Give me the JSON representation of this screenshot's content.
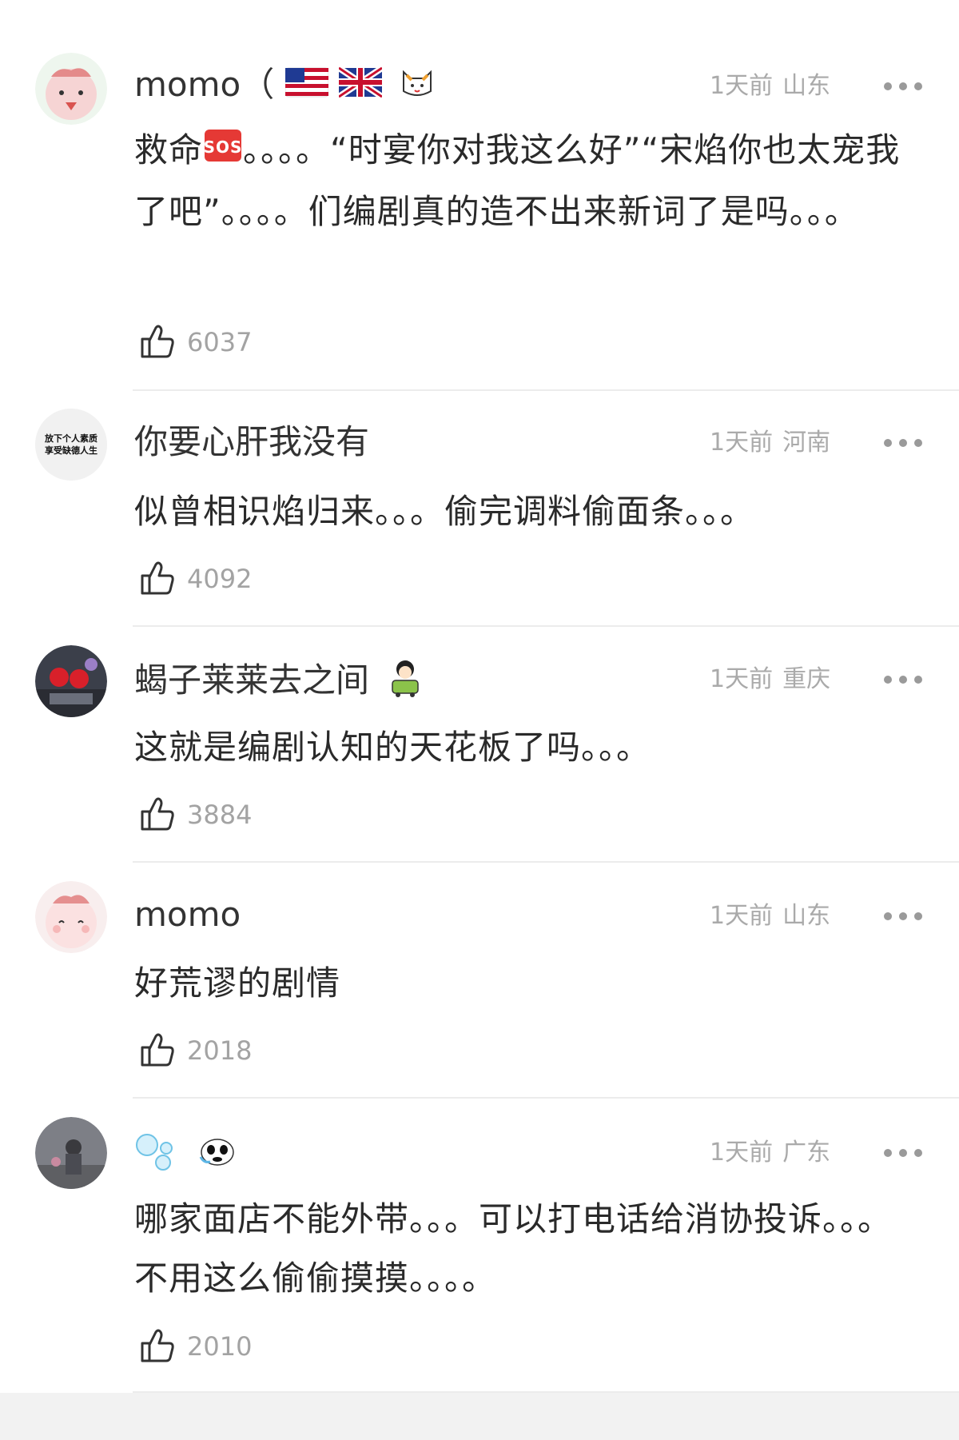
{
  "colors": {
    "background": "#ffffff",
    "username": "#333333",
    "meta": "#aaaaaa",
    "content": "#2a2a2a",
    "like": "#a3a3a3",
    "divider": "#ececec"
  },
  "comments": [
    {
      "username": "momo（",
      "username_icons": [
        "us-flag-icon",
        "uk-flag-icon",
        "cat-face-icon"
      ],
      "time": "1天前",
      "location": "山东",
      "content_before_icon": "救命",
      "content_icon": "sos-icon",
      "content": "。。。。“时宴你对我这么好”“宋焰你也太宠我了吧”。。。。们编剧真的造不出来新词了是吗。。。",
      "likes": "6037"
    },
    {
      "username": "你要心肝我没有",
      "avatar_text": "放下个人素质 享受缺德人生",
      "time": "1天前",
      "location": "河南",
      "content": "似曾相识焰归来。。。偷完调料偷面条。。。",
      "likes": "4092"
    },
    {
      "username": "蝎子莱莱去之间",
      "username_icons": [
        "cartoon-girl-sticker-icon"
      ],
      "time": "1天前",
      "location": "重庆",
      "content": "这就是编剧认知的天花板了吗。。。",
      "likes": "3884"
    },
    {
      "username": "momo",
      "time": "1天前",
      "location": "山东",
      "content": "好荒谬的剧情",
      "likes": "2018"
    },
    {
      "username": "",
      "username_icons": [
        "bubbles-icon",
        "panda-icon"
      ],
      "time": "1天前",
      "location": "广东",
      "content": "哪家面店不能外带。。。可以打电话给消协投诉。。。不用这么偷偷摸摸。。。。",
      "likes": "2010"
    }
  ]
}
